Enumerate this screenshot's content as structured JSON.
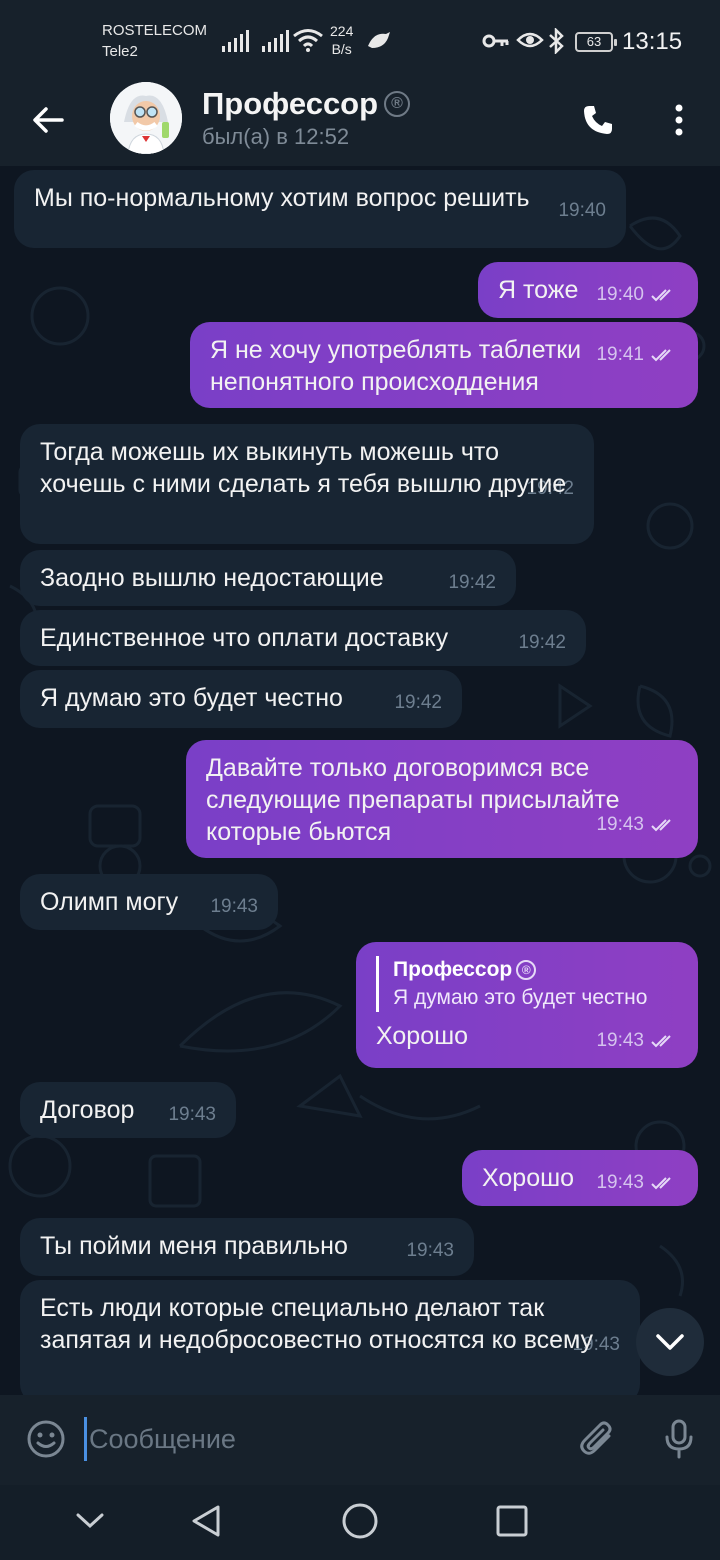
{
  "status_bar": {
    "carrier_1": "ROSTELECOM",
    "carrier_2": "Tele2",
    "speed_value": "224",
    "speed_unit": "B/s",
    "battery": "63",
    "time": "13:15"
  },
  "header": {
    "title": "Профессор",
    "registered_mark": "®",
    "last_seen": "был(а) в 12:52"
  },
  "messages": [
    {
      "dir": "in",
      "text": "Мы по-нормальному хотим вопрос решить",
      "time": "19:40"
    },
    {
      "dir": "out",
      "text": "Я тоже",
      "time": "19:40"
    },
    {
      "dir": "out",
      "text": "Я не хочу употреблять таблетки непонятного происходдения",
      "time": "19:41"
    },
    {
      "dir": "in",
      "text": "Тогда можешь их выкинуть можешь что хочешь с ними сделать я тебя вышлю другие",
      "time": "19:42"
    },
    {
      "dir": "in",
      "text": "Заодно вышлю недостающие",
      "time": "19:42"
    },
    {
      "dir": "in",
      "text": "Единственное что оплати доставку",
      "time": "19:42"
    },
    {
      "dir": "in",
      "text": "Я думаю это будет честно",
      "time": "19:42"
    },
    {
      "dir": "out",
      "text": "Давайте только договоримся все следующие препараты присылайте которые бьются",
      "time": "19:43"
    },
    {
      "dir": "in",
      "text": "Олимп могу",
      "time": "19:43"
    },
    {
      "dir": "out",
      "text": "Хорошо",
      "time": "19:43",
      "reply": {
        "author": "Профессор",
        "mark": "®",
        "text": "Я думаю это будет честно"
      }
    },
    {
      "dir": "in",
      "text": "Договор",
      "time": "19:43"
    },
    {
      "dir": "out",
      "text": "Хорошо",
      "time": "19:43"
    },
    {
      "dir": "in",
      "text": "Ты пойми меня правильно",
      "time": "19:43"
    },
    {
      "dir": "in",
      "text": "Есть люди которые специально делают так запятая и недобросовестно относятся ко всему",
      "time": "19:43"
    }
  ],
  "composer": {
    "placeholder": "Сообщение"
  },
  "icons": {
    "back": "arrow-left-icon",
    "call": "phone-icon",
    "menu": "more-vertical-icon",
    "emoji": "emoji-icon",
    "attach": "paperclip-icon",
    "mic": "microphone-icon",
    "scroll_down": "chevron-down-icon"
  },
  "colors": {
    "background": "#0e1621",
    "bar": "#17212b",
    "incoming_bubble": "#182533",
    "outgoing_bubble": "#8342c4",
    "accent": "#4a90e2"
  }
}
